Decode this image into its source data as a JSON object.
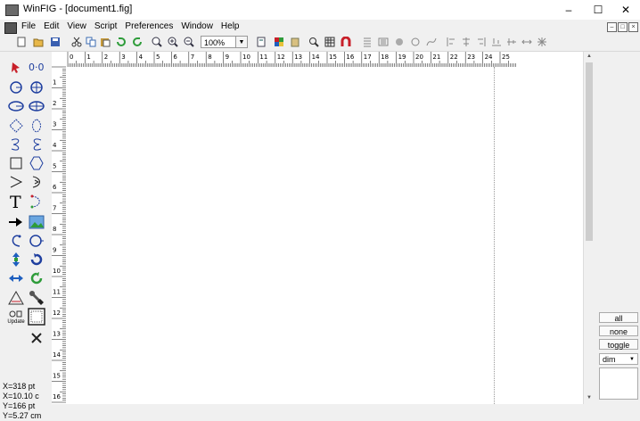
{
  "window": {
    "title": "WinFIG - [document1.fig]",
    "minimize": "–",
    "maximize": "☐",
    "close": "✕"
  },
  "menu": {
    "items": [
      "File",
      "Edit",
      "View",
      "Script",
      "Preferences",
      "Window",
      "Help"
    ],
    "mdi_buttons": [
      "–",
      "□",
      "×"
    ]
  },
  "toolbar": {
    "zoom_value": "100%",
    "zoom_arrow": "▼"
  },
  "palette": {
    "update_label": "Update",
    "coords": {
      "x_pt": "X=318 pt",
      "x_cm": "X=10.10 c",
      "y_pt": "Y=166 pt",
      "y_cm": "Y=5.27 cm"
    }
  },
  "rulers": {
    "horizontal_labels": [
      "0",
      "1",
      "2",
      "3",
      "4",
      "5",
      "6",
      "7",
      "8",
      "9",
      "10",
      "11",
      "12",
      "13",
      "14",
      "15",
      "16",
      "17",
      "18",
      "19",
      "20",
      "21",
      "22",
      "23",
      "24",
      "25"
    ],
    "vertical_labels": [
      "1",
      "2",
      "3",
      "4",
      "5",
      "6",
      "7",
      "8",
      "9",
      "10",
      "11",
      "12",
      "13",
      "14",
      "15",
      "16"
    ]
  },
  "depth_panel": {
    "all_label": "all",
    "none_label": "none",
    "toggle_label": "toggle",
    "dim_value": "dim",
    "dim_arrow": "▼"
  },
  "colors": {
    "accent_green": "#2e9c3a",
    "accent_blue": "#1f5fbf",
    "accent_red": "#c8202a"
  }
}
